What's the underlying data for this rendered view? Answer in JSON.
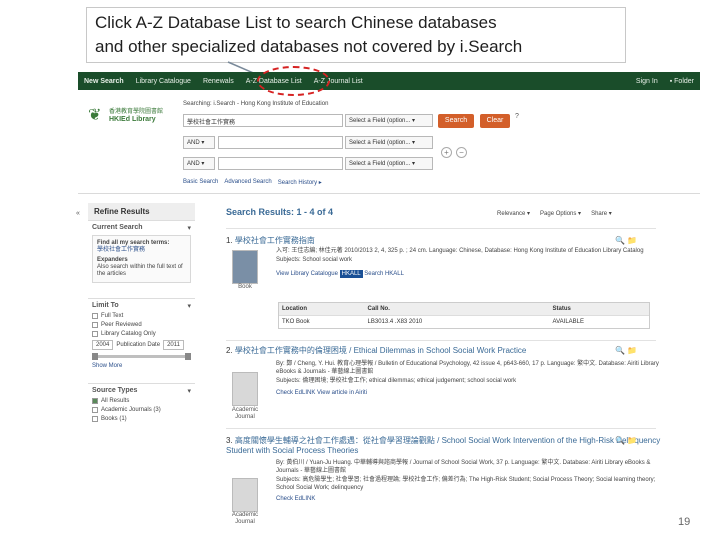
{
  "callout": {
    "line1": "Click A-Z Database List to search Chinese databases",
    "line2": "and other specialized databases not covered by i.Search"
  },
  "topnav": {
    "items": [
      "New Search",
      "Library Catalogue",
      "Renewals",
      "A-Z Database List",
      "A-Z Journal List"
    ],
    "right": [
      "Sign In",
      "Folder"
    ]
  },
  "logo": {
    "line1": "香港教育學院圖書館",
    "line2": "HKIEd Library"
  },
  "search": {
    "label": "Searching: i.Search - Hong Kong Institute of Education",
    "query": "學校社會工作實務",
    "field_select": "Select a Field (option...",
    "bool1": "AND",
    "bool2": "AND",
    "search_label": "Search",
    "clear_label": "Clear",
    "help": "?",
    "sublinks": [
      "Basic Search",
      "Advanced Search",
      "Search History"
    ]
  },
  "refine": {
    "collapse": "«",
    "title": "Refine Results",
    "current_search": "Current Search",
    "find_all": "Find all my search terms:",
    "term": "學校社會工作實務",
    "expanders": "Expanders",
    "expander_text": "Also search within the full text of the articles",
    "limit_to": "Limit To",
    "limits": [
      "Full Text",
      "Peer Reviewed",
      "Library Catalog Only"
    ],
    "date_from": "2004",
    "date_label": "Publication Date",
    "date_to": "2011",
    "show_more": "Show More",
    "source_types": "Source Types",
    "sources": [
      "All Results",
      "Academic Journals (3)",
      "Books (1)"
    ]
  },
  "results": {
    "head": "Search Results: 1 - 4 of 4",
    "tools": [
      "Relevance ▾",
      "Page Options ▾",
      "Share ▾"
    ],
    "records": [
      {
        "num": "1.",
        "title": "學校社會工作實務指南",
        "meta1": "入可: 王佳志編; 林佳元著 2010/2013 2, 4, 325 p. ; 24 cm. Language: Chinese, Database: Hong Kong Institute of Education Library Catalog",
        "meta2": "Subjects: School social work",
        "type": "Book",
        "links": [
          "View Library Catalogue",
          "HKALL",
          "Search HKALL"
        ],
        "table_head": [
          "Location",
          "Call No.",
          "Status"
        ],
        "table_row": [
          "TKO Book",
          "LB3013.4 .X83 2010",
          "AVAILABLE"
        ]
      },
      {
        "num": "2.",
        "title": "學校社會工作實務中的倫理困境 / Ethical Dilemmas in School Social Work Practice",
        "meta1": "By: 鄭 / Cheng, Y. Hui. 教育心理學報 / Bulletin of Educational Psychology, 42 issue 4, p643-660, 17 p. Language: 繁中文. Database: Airiti Library eBooks & Journals - 華藝線上圖書館",
        "meta2": "Subjects: 倫理困境; 學校社會工作; ethical dilemmas; ethical judgement; school social work",
        "type": "Academic Journal",
        "links": [
          "Check EdLINK",
          "View article in Airiti"
        ]
      },
      {
        "num": "3.",
        "title": "高度關懷學生輔導之社會工作處遇：從社會學習理論觀點 / School Social Work Intervention of the High-Risk Delinquency Student with Social Process Theories",
        "meta1": "By: 黃伯川 / Yuan-Ju Huang. 中華輔導與諮商學報 / Journal of School Social Work, 37 p. Language: 繁中文. Database: Airiti Library eBooks & Journals - 華藝線上圖書館",
        "meta2": "Subjects: 高危險學生; 社會學習; 社會過程理論; 學校社會工作; 偏差行為; The High-Risk Student; Social Process Theory; Social learning theory; School Social Work; delinquency",
        "type": "Academic Journal",
        "links": [
          "Check EdLINK"
        ]
      }
    ]
  },
  "page_number": "19"
}
